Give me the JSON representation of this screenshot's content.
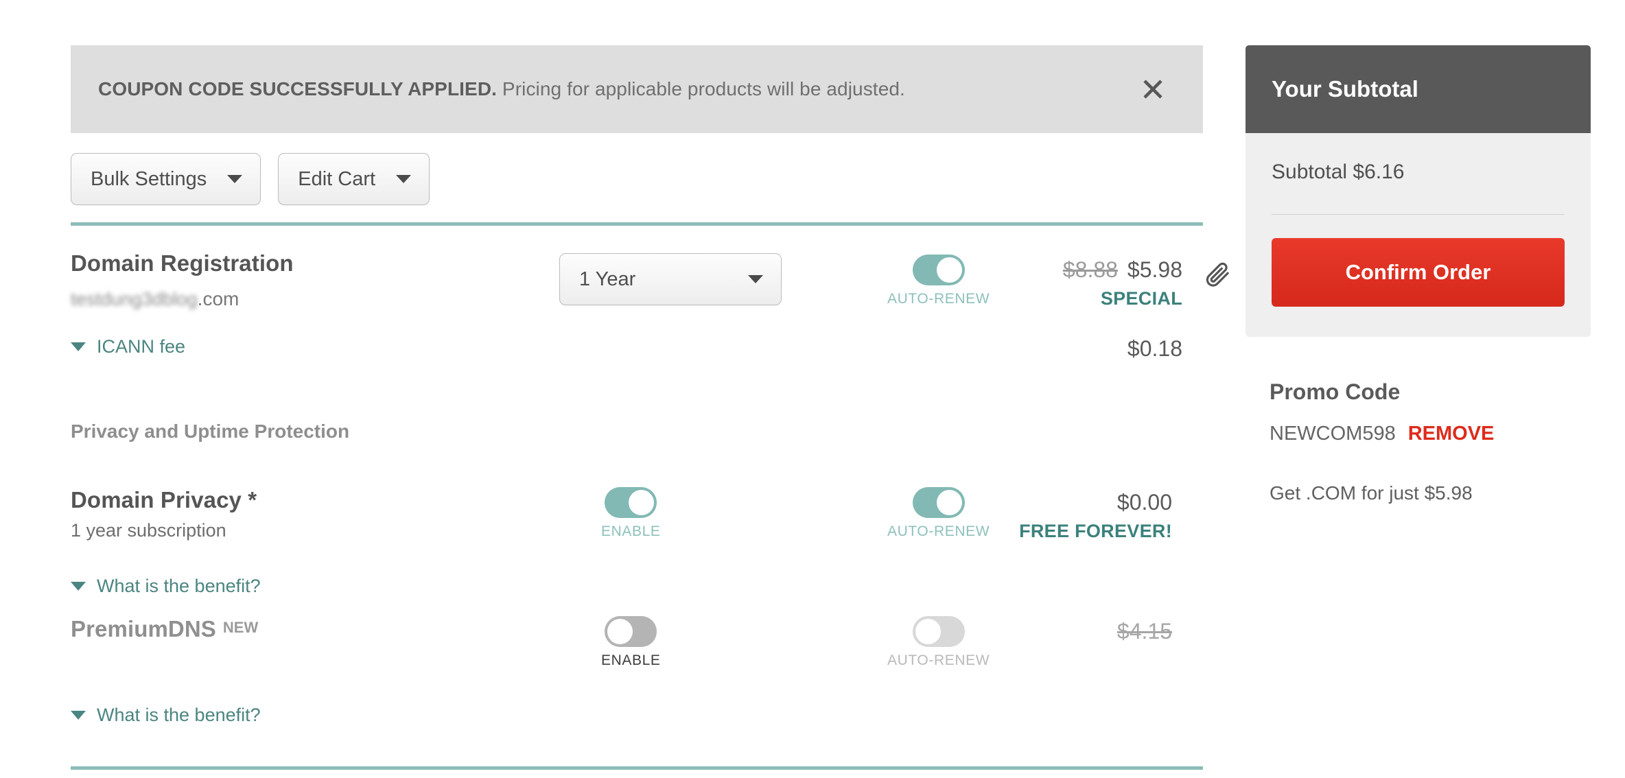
{
  "banner": {
    "strong": "COUPON CODE SUCCESSFULLY APPLIED.",
    "message": "Pricing for applicable products will be adjusted.",
    "close_icon": "close-icon"
  },
  "toolbar": {
    "bulk_settings": "Bulk Settings",
    "edit_cart": "Edit Cart"
  },
  "domain_row": {
    "title": "Domain Registration",
    "domain_redacted": "testdung3dblog",
    "domain_tld": ".com",
    "term": "1 Year",
    "autorenew_label": "AUTO-RENEW",
    "price_old": "$8.88",
    "price_new": "$5.98",
    "price_tag": "SPECIAL",
    "attach_icon": "paperclip-icon",
    "remove_icon": "close-icon",
    "icann_label": "ICANN fee",
    "icann_price": "$0.18"
  },
  "protection_section": {
    "heading": "Privacy and Uptime Protection"
  },
  "privacy_row": {
    "title": "Domain Privacy *",
    "subtitle": "1 year subscription",
    "enable_label": "ENABLE",
    "autorenew_label": "AUTO-RENEW",
    "price": "$0.00",
    "price_tag": "FREE FOREVER!",
    "benefit_link": "What is the benefit?"
  },
  "premiumdns_row": {
    "title": "PremiumDNS",
    "badge": "NEW",
    "enable_label": "ENABLE",
    "autorenew_label": "AUTO-RENEW",
    "price_struck": "$4.15",
    "benefit_link": "What is the benefit?"
  },
  "sidebar": {
    "header_title": "Your Subtotal",
    "subtotal_line": "Subtotal $6.16",
    "confirm_label": "Confirm Order",
    "promo_title": "Promo Code",
    "promo_code": "NEWCOM598",
    "promo_remove": "REMOVE",
    "promo_note": "Get .COM for just $5.98"
  },
  "colors": {
    "teal": "#82b9b4",
    "teal_text": "#4b8581",
    "red": "#dd2b1c",
    "banner_bg": "#dedede",
    "sidebar_header": "#595959",
    "sidebar_body": "#efefef"
  }
}
